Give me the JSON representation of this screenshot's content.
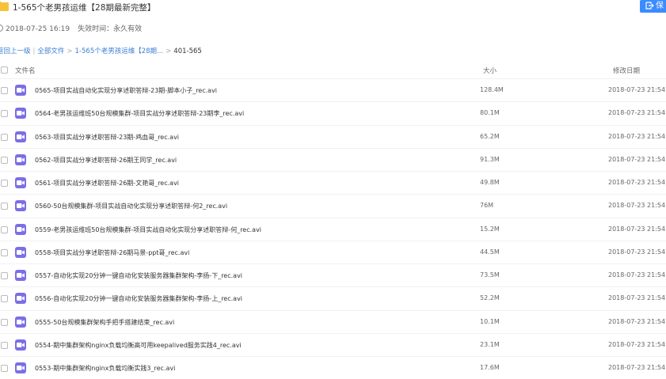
{
  "header": {
    "folder_title": "1-565个老男孩运维【28期最新完整】",
    "date": "2018-07-25 16:19",
    "expiry_label": "失效时间：",
    "expiry_value": "永久有效",
    "save_label": "保"
  },
  "breadcrumb": {
    "back": "返回上一级",
    "all_files": "全部文件",
    "folder": "1-565个老男孩运维【28期...",
    "current": "401-565"
  },
  "table": {
    "col_name": "文件名",
    "col_size": "大小",
    "col_date": "修改日期",
    "rows": [
      {
        "name": "0565-项目实战自动化实现分享述职答辩-23期-脚本小子_rec.avi",
        "size": "128.4M",
        "date": "2018-07-23 21:54"
      },
      {
        "name": "0564-老男孩运维班50台规模集群-项目实战分享述职答辩-23期李_rec.avi",
        "size": "80.1M",
        "date": "2018-07-23 21:54"
      },
      {
        "name": "0563-项目实战分享述职答辩-23期-鸡血哥_rec.avi",
        "size": "65.2M",
        "date": "2018-07-23 21:54"
      },
      {
        "name": "0562-项目实战分享述职答辩-26期王同学_rec.avi",
        "size": "91.3M",
        "date": "2018-07-23 21:54"
      },
      {
        "name": "0561-项目实战分享述职答辩-26期-文艳哥_rec.avi",
        "size": "49.8M",
        "date": "2018-07-23 21:54"
      },
      {
        "name": "0560-50台规模集群-项目实战自动化实现分享述职答辩-何2_rec.avi",
        "size": "76M",
        "date": "2018-07-23 21:54"
      },
      {
        "name": "0559-老男孩运维班50台规模集群-项目实战自动化实现分享述职答辩-何_rec.avi",
        "size": "15.2M",
        "date": "2018-07-23 21:54"
      },
      {
        "name": "0558-项目实战分享述职答辩-26期马景-ppt哥_rec.avi",
        "size": "44.5M",
        "date": "2018-07-23 21:54"
      },
      {
        "name": "0557-自动化实现20分钟一键自动化安装服务器集群架构-李扬-下_rec.avi",
        "size": "73.5M",
        "date": "2018-07-23 21:54"
      },
      {
        "name": "0556-自动化实现20分钟一键自动化安装服务器集群架构-李扬-上_rec.avi",
        "size": "52.2M",
        "date": "2018-07-23 21:54"
      },
      {
        "name": "0555-50台规模集群架构手把手搭建结束_rec.avi",
        "size": "10.1M",
        "date": "2018-07-23 21:54"
      },
      {
        "name": "0554-期中集群架构nginx负载均衡高可用keepalived服务实践4_rec.avi",
        "size": "23.1M",
        "date": "2018-07-23 21:54"
      },
      {
        "name": "0553-期中集群架构nginx负载均衡实践3_rec.avi",
        "size": "17.6M",
        "date": "2018-07-23 21:54"
      }
    ]
  },
  "colors": {
    "accent": "#3b8cff",
    "video_icon": "#7b6ee6",
    "folder_icon": "#f7c23b",
    "link": "#3b7fd4"
  },
  "icons": {
    "folder": "folder-icon",
    "clock": "clock-icon",
    "save": "save-icon",
    "video": "video-file-icon"
  }
}
